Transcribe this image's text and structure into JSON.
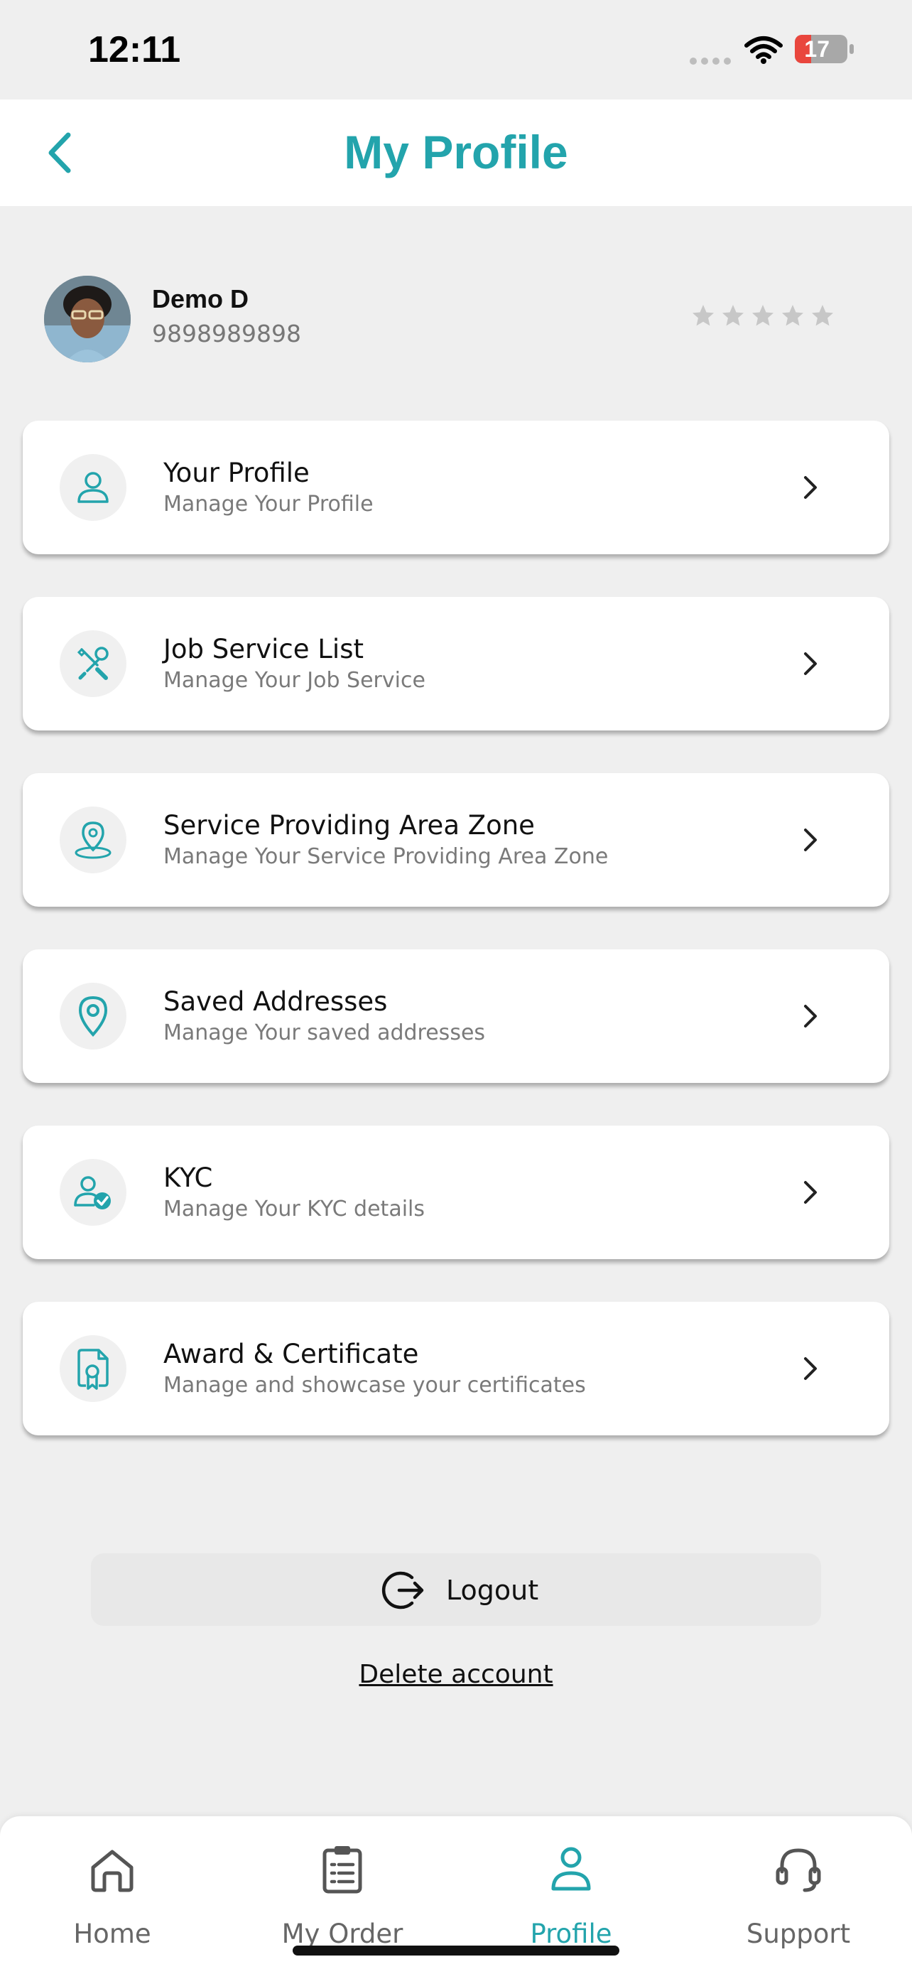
{
  "status_bar": {
    "time": "12:11",
    "battery": "17"
  },
  "header": {
    "title": "My Profile",
    "back_icon": "chevron-left-icon"
  },
  "user": {
    "name": "Demo D",
    "phone": "9898989898",
    "rating_stars": 5
  },
  "menu": [
    {
      "title": "Your Profile",
      "subtitle": "Manage Your Profile",
      "icon": "user-icon"
    },
    {
      "title": "Job Service List",
      "subtitle": "Manage Your Job Service",
      "icon": "tools-icon"
    },
    {
      "title": "Service Providing Area Zone",
      "subtitle": "Manage Your Service Providing Area Zone",
      "icon": "area-pin-icon"
    },
    {
      "title": "Saved Addresses",
      "subtitle": "Manage Your saved addresses",
      "icon": "location-pin-icon"
    },
    {
      "title": "KYC",
      "subtitle": "Manage Your KYC details",
      "icon": "user-check-icon"
    },
    {
      "title": "Award & Certificate",
      "subtitle": "Manage and showcase your certificates",
      "icon": "certificate-icon"
    }
  ],
  "actions": {
    "logout": "Logout",
    "delete_account": "Delete account"
  },
  "bottom_nav": [
    {
      "label": "Home",
      "icon": "home-icon",
      "active": false
    },
    {
      "label": "My Order",
      "icon": "clipboard-list-icon",
      "active": false
    },
    {
      "label": "Profile",
      "icon": "user-icon",
      "active": true
    },
    {
      "label": "Support",
      "icon": "headset-icon",
      "active": false
    }
  ],
  "colors": {
    "accent": "#23a4ac",
    "background": "#efefef",
    "card": "#ffffff",
    "battery_low": "#e9463d"
  }
}
